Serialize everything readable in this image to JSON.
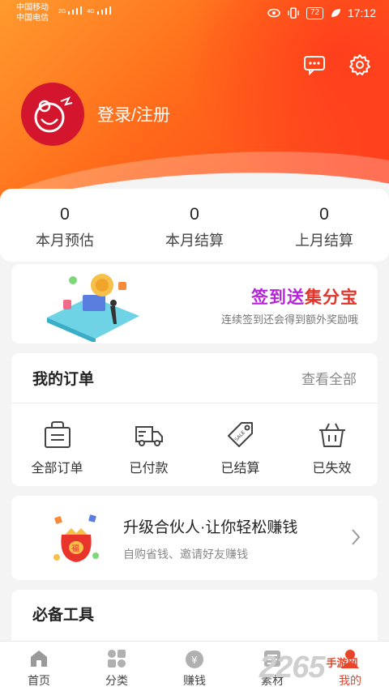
{
  "status_bar": {
    "carrier1": "中国移动",
    "carrier2": "中国电信",
    "net1": "2G",
    "net2": "4G",
    "battery": "72",
    "time": "17:12"
  },
  "header": {
    "message_icon": "chat-bubble-icon",
    "settings_icon": "gear-icon",
    "login_label": "登录/注册",
    "hero_colors": [
      "#ff9a2e",
      "#ff6a1a",
      "#ff3b1e"
    ]
  },
  "stats": [
    {
      "value": "0",
      "label": "本月预估"
    },
    {
      "value": "0",
      "label": "本月结算"
    },
    {
      "value": "0",
      "label": "上月结算"
    }
  ],
  "banner": {
    "title_part1": "签到送",
    "title_part2": "集分宝",
    "subtitle": "连续签到还会得到额外奖励哦"
  },
  "orders": {
    "title": "我的订单",
    "view_all": "查看全部",
    "items": [
      {
        "label": "全部订单",
        "icon": "shopping-bag-icon"
      },
      {
        "label": "已付款",
        "icon": "delivery-truck-icon"
      },
      {
        "label": "已结算",
        "icon": "price-tag-icon"
      },
      {
        "label": "已失效",
        "icon": "basket-icon"
      }
    ]
  },
  "partner": {
    "title": "升级合伙人·让你轻松赚钱",
    "subtitle": "自购省钱、邀请好友赚钱"
  },
  "tools": {
    "title": "必备工具"
  },
  "bottom_nav": {
    "items": [
      {
        "label": "首页",
        "icon": "home-icon"
      },
      {
        "label": "分类",
        "icon": "category-grid-icon"
      },
      {
        "label": "赚钱",
        "icon": "money-bag-icon"
      },
      {
        "label": "素材",
        "icon": "material-icon"
      },
      {
        "label": "我的",
        "icon": "profile-icon"
      }
    ],
    "active_index": 4,
    "active_color": "#e8442a"
  },
  "watermark": {
    "number": "2265",
    "site": "手游网"
  }
}
